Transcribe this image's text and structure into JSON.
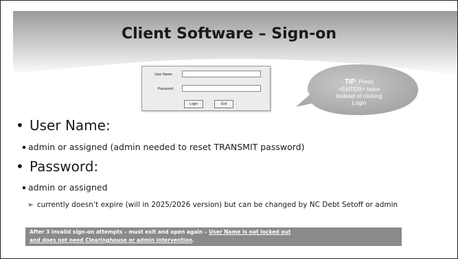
{
  "slide": {
    "title": "Client Software – Sign-on"
  },
  "dialog": {
    "username_label": "User Name:",
    "password_label": "Password:",
    "username_value": "",
    "password_value": "",
    "login_button": "Login",
    "exit_button": "Exit"
  },
  "tip": {
    "heading": "TIP",
    "line1": ": Press",
    "line2": "<ENTER> twice",
    "line3": "instead of clicking",
    "line4": "Login"
  },
  "content": {
    "bullet_username": "User Name:",
    "sub_username": "admin or assigned (admin needed to reset TRANSMIT password)",
    "bullet_password": "Password:",
    "sub_password": "admin or assigned",
    "subsub_password": "currently doesn’t expire (will in 2025/2026 version) but can be changed by NC Debt Setoff or admin",
    "note_part1": "After 3 invalid sign-on attempts – must exit and open again – ",
    "note_underlined": "User Name is not locked out",
    "note_part2_underlined": "and does not need Clearinghouse or admin intervention",
    "note_end": "."
  },
  "colors": {
    "header_gradient_top": "#9a9a9a",
    "header_gradient_bottom": "#ffffff",
    "tip_bubble": "#b4b4b4",
    "note_background": "#8a8a8a"
  }
}
